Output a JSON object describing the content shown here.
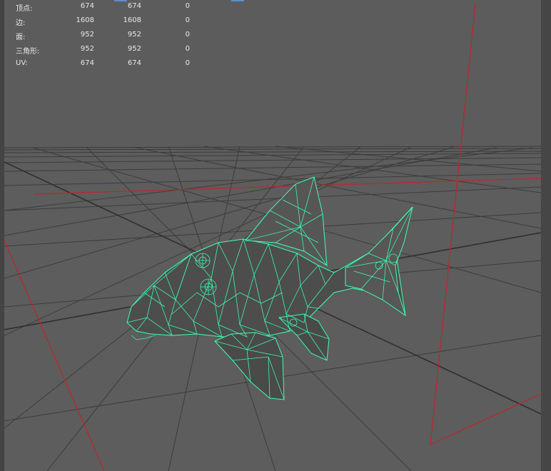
{
  "heads_up_display": {
    "poly_count": [
      {
        "label": "顶点:",
        "values": [
          "674",
          "674",
          "0"
        ]
      },
      {
        "label": "边:",
        "values": [
          "1608",
          "1608",
          "0"
        ]
      },
      {
        "label": "面:",
        "values": [
          "952",
          "952",
          "0"
        ]
      },
      {
        "label": "三角形:",
        "values": [
          "952",
          "952",
          "0"
        ]
      },
      {
        "label": "UV:",
        "values": [
          "674",
          "674",
          "0"
        ]
      }
    ]
  },
  "viewport": {
    "background_color": "#5d5d5d",
    "grid_color": "#3c3c3c",
    "axis_color": "#c0252a",
    "wireframe_color": "#3dffb0",
    "mesh_fill_color": "#4a4a4a",
    "object": "fish mesh (wireframe on shaded)"
  }
}
